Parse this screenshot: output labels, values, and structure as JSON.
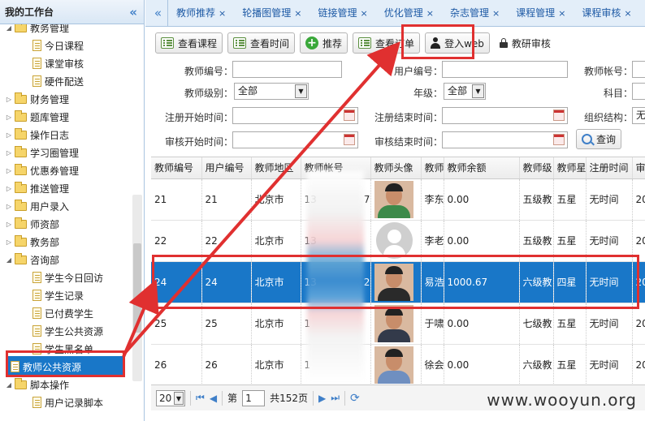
{
  "sidebar": {
    "title": "我的工作台",
    "collapse_glyph": "«",
    "items": [
      {
        "label": "教务管理",
        "type": "folder",
        "level": 1,
        "open": true
      },
      {
        "label": "今日课程",
        "type": "file",
        "level": 2
      },
      {
        "label": "课堂审核",
        "type": "file",
        "level": 2
      },
      {
        "label": "硬件配送",
        "type": "file",
        "level": 2
      },
      {
        "label": "财务管理",
        "type": "folder",
        "level": 1,
        "open": false
      },
      {
        "label": "题库管理",
        "type": "folder",
        "level": 1,
        "open": false
      },
      {
        "label": "操作日志",
        "type": "folder",
        "level": 1,
        "open": false
      },
      {
        "label": "学习圈管理",
        "type": "folder",
        "level": 1,
        "open": false
      },
      {
        "label": "优惠券管理",
        "type": "folder",
        "level": 1,
        "open": false
      },
      {
        "label": "推送管理",
        "type": "folder",
        "level": 1,
        "open": false
      },
      {
        "label": "用户录入",
        "type": "folder",
        "level": 1,
        "open": false
      },
      {
        "label": "师资部",
        "type": "folder",
        "level": 1,
        "open": false
      },
      {
        "label": "教务部",
        "type": "folder",
        "level": 1,
        "open": false
      },
      {
        "label": "咨询部",
        "type": "folder",
        "level": 1,
        "open": true
      },
      {
        "label": "学生今日回访",
        "type": "file",
        "level": 2
      },
      {
        "label": "学生记录",
        "type": "file",
        "level": 2
      },
      {
        "label": "已付费学生",
        "type": "file",
        "level": 2
      },
      {
        "label": "学生公共资源",
        "type": "file",
        "level": 2
      },
      {
        "label": "学生黑名单",
        "type": "file",
        "level": 2
      },
      {
        "label": "教师公共资源",
        "type": "file",
        "level": 2,
        "selected": true
      },
      {
        "label": "脚本操作",
        "type": "folder",
        "level": 1,
        "open": true
      },
      {
        "label": "用户记录脚本",
        "type": "file",
        "level": 2
      }
    ]
  },
  "tabs": {
    "collapse_glyph": "«",
    "items": [
      "教师推荐",
      "轮播图管理",
      "链接管理",
      "优化管理",
      "杂志管理",
      "课程管理",
      "课程审核"
    ],
    "close_glyph": "×"
  },
  "toolbar": {
    "view_course": "查看课程",
    "view_time": "查看时间",
    "recommend": "推荐",
    "view_order": "查看订单",
    "login_web": "登入web",
    "research_audit": "教研审核"
  },
  "form": {
    "teacher_no": "教师编号：",
    "user_no": "用户编号：",
    "teacher_account": "教师帐号：",
    "teacher_level": "教师级别：",
    "teacher_level_value": "全部",
    "grade": "年级：",
    "grade_value": "全部",
    "subject": "科目：",
    "reg_start": "注册开始时间：",
    "reg_end": "注册结束时间：",
    "org": "组织结构：",
    "org_value": "无",
    "audit_start": "审核开始时间：",
    "audit_end": "审核结束时间：",
    "query": "查询"
  },
  "table": {
    "columns": [
      "教师编号",
      "用户编号",
      "教师地区",
      "教师帐号",
      "教师头像",
      "教师",
      "教师余额",
      "教师级",
      "教师星",
      "注册时间",
      "审"
    ],
    "rows": [
      {
        "teacher_no": "21",
        "user_no": "21",
        "region": "北京市",
        "account": "13",
        "account_tail": "7",
        "avatar": "green",
        "name": "李东",
        "balance": "0.00",
        "level": "五级教",
        "star": "五星",
        "reg": "无时间",
        "audit": "20"
      },
      {
        "teacher_no": "22",
        "user_no": "22",
        "region": "北京市",
        "account": "13",
        "account_tail": "",
        "avatar": "placeholder",
        "name": "李老",
        "balance": "0.00",
        "level": "五级教",
        "star": "五星",
        "reg": "无时间",
        "audit": "20"
      },
      {
        "teacher_no": "24",
        "user_no": "24",
        "region": "北京市",
        "account": "13",
        "account_tail": "2",
        "avatar": "dark",
        "name": "易浩",
        "balance": "1000.67",
        "level": "六级教",
        "star": "四星",
        "reg": "无时间",
        "audit": "20",
        "highlighted": true
      },
      {
        "teacher_no": "25",
        "user_no": "25",
        "region": "北京市",
        "account": "1",
        "account_tail": "",
        "avatar": "suit",
        "name": "于啸",
        "balance": "0.00",
        "level": "七级教",
        "star": "五星",
        "reg": "无时间",
        "audit": "20"
      },
      {
        "teacher_no": "26",
        "user_no": "26",
        "region": "北京市",
        "account": "1",
        "account_tail": "",
        "avatar": "blue",
        "name": "徐会",
        "balance": "0.00",
        "level": "六级教",
        "star": "五星",
        "reg": "无时间",
        "audit": "20"
      }
    ]
  },
  "pager": {
    "page_size": "20",
    "page_prefix": "第",
    "page": "1",
    "page_total": "共152页"
  },
  "watermark": "www.wooyun.org",
  "colors": {
    "accent": "#1977c8",
    "annotation_red": "#e03030",
    "tab_text": "#1e5aa5"
  },
  "icons": [
    "collapse-icon",
    "folder-icon",
    "file-icon",
    "grid-icon",
    "plus-icon",
    "user-icon",
    "lock-icon",
    "search-icon",
    "calendar-icon",
    "first-page-icon",
    "prev-page-icon",
    "next-page-icon",
    "last-page-icon",
    "refresh-icon"
  ]
}
